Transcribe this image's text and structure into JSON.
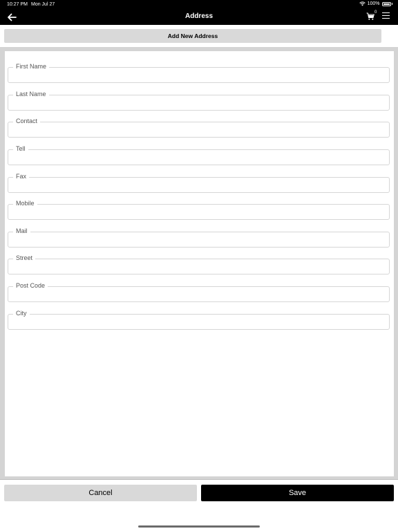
{
  "status_bar": {
    "time": "10:27 PM",
    "date": "Mon Jul 27",
    "battery": "100%"
  },
  "nav": {
    "title": "Address",
    "cart_count": "0",
    "icons": [
      "arrow-left-icon",
      "cart-icon",
      "hamburger-menu-icon"
    ]
  },
  "add_button_label": "Add New Address",
  "form": {
    "fields": [
      {
        "label": "First Name",
        "value": ""
      },
      {
        "label": "Last Name",
        "value": ""
      },
      {
        "label": "Contact",
        "value": ""
      },
      {
        "label": "Tell",
        "value": ""
      },
      {
        "label": "Fax",
        "value": ""
      },
      {
        "label": "Mobile",
        "value": ""
      },
      {
        "label": "Mail",
        "value": ""
      },
      {
        "label": "Street",
        "value": ""
      },
      {
        "label": "Post Code",
        "value": ""
      },
      {
        "label": "City",
        "value": ""
      }
    ]
  },
  "actions": {
    "cancel_label": "Cancel",
    "save_label": "Save"
  },
  "colors": {
    "header_bg": "#000000",
    "secondary_button": "#d9d9d9",
    "primary_button": "#000000"
  }
}
